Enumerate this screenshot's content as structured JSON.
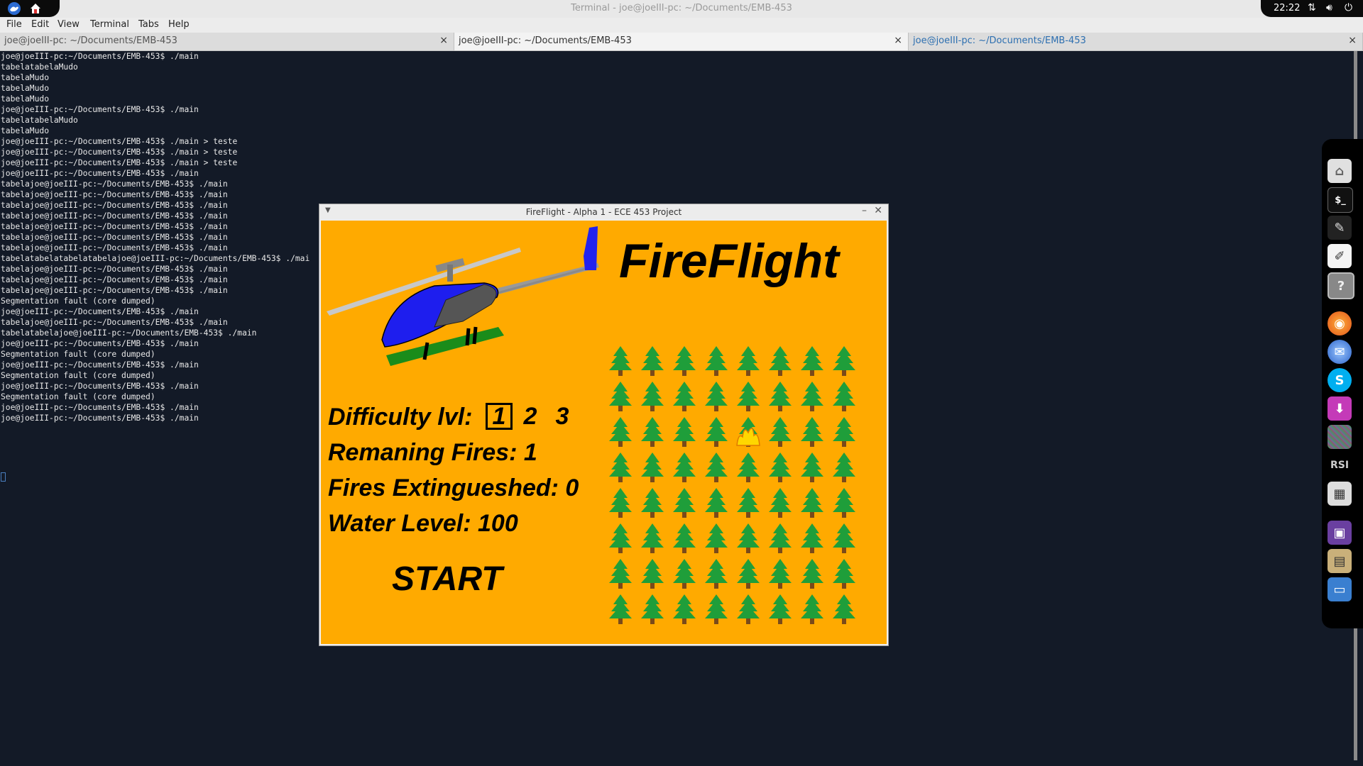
{
  "panel": {
    "window_title": "Terminal - joe@joeIII-pc: ~/Documents/EMB-453",
    "clock": "22:22"
  },
  "menubar": {
    "items": [
      "File",
      "Edit",
      "View",
      "Terminal",
      "Tabs",
      "Help"
    ]
  },
  "tabs": [
    {
      "label": "joe@joeIII-pc: ~/Documents/EMB-453",
      "close": "×"
    },
    {
      "label": "joe@joeIII-pc: ~/Documents/EMB-453",
      "close": "×"
    },
    {
      "label": "joe@joeIII-pc: ~/Documents/EMB-453",
      "close": "×"
    }
  ],
  "terminal": {
    "lines": [
      "joe@joeIII-pc:~/Documents/EMB-453$ ./main",
      "tabelatabelaMudo",
      "tabelaMudo",
      "tabelaMudo",
      "tabelaMudo",
      "joe@joeIII-pc:~/Documents/EMB-453$ ./main",
      "tabelatabelaMudo",
      "tabelaMudo",
      "joe@joeIII-pc:~/Documents/EMB-453$ ./main > teste",
      "joe@joeIII-pc:~/Documents/EMB-453$ ./main > teste",
      "joe@joeIII-pc:~/Documents/EMB-453$ ./main > teste",
      "joe@joeIII-pc:~/Documents/EMB-453$ ./main",
      "tabelajoe@joeIII-pc:~/Documents/EMB-453$ ./main",
      "tabelajoe@joeIII-pc:~/Documents/EMB-453$ ./main",
      "tabelajoe@joeIII-pc:~/Documents/EMB-453$ ./main",
      "tabelajoe@joeIII-pc:~/Documents/EMB-453$ ./main",
      "tabelajoe@joeIII-pc:~/Documents/EMB-453$ ./main",
      "tabelajoe@joeIII-pc:~/Documents/EMB-453$ ./main",
      "tabelajoe@joeIII-pc:~/Documents/EMB-453$ ./main",
      "tabelatabelatabelatabelajoe@joeIII-pc:~/Documents/EMB-453$ ./mai",
      "tabelajoe@joeIII-pc:~/Documents/EMB-453$ ./main",
      "tabelajoe@joeIII-pc:~/Documents/EMB-453$ ./main",
      "tabelajoe@joeIII-pc:~/Documents/EMB-453$ ./main",
      "Segmentation fault (core dumped)",
      "joe@joeIII-pc:~/Documents/EMB-453$ ./main",
      "tabelajoe@joeIII-pc:~/Documents/EMB-453$ ./main",
      "tabelatabelajoe@joeIII-pc:~/Documents/EMB-453$ ./main",
      "joe@joeIII-pc:~/Documents/EMB-453$ ./main",
      "Segmentation fault (core dumped)",
      "joe@joeIII-pc:~/Documents/EMB-453$ ./main",
      "Segmentation fault (core dumped)",
      "joe@joeIII-pc:~/Documents/EMB-453$ ./main",
      "Segmentation fault (core dumped)",
      "joe@joeIII-pc:~/Documents/EMB-453$ ./main",
      "joe@joeIII-pc:~/Documents/EMB-453$ ./main"
    ]
  },
  "game": {
    "window_title": "FireFlight - Alpha 1 - ECE 453 Project",
    "logo": "FireFlight",
    "difficulty_label": "Difficulty lvl:",
    "levels": [
      "1",
      "2",
      "3"
    ],
    "selected_level": "1",
    "remaining_fires": "Remaning Fires: 1",
    "fires_extinguished": "Fires Extingueshed: 0",
    "water_level": "Water Level: 100",
    "start": "START",
    "forest": {
      "rows": 8,
      "cols": 8,
      "fire_at": [
        2,
        4
      ]
    },
    "colors": {
      "background": "#ffaa00",
      "tree": "#1f9e3a",
      "trunk": "#7a4a1a",
      "fire": "#ffd700"
    }
  },
  "dock": {
    "icons": [
      "home-folder-icon",
      "terminal-icon",
      "text-editor-icon",
      "notes-icon",
      "help-icon",
      "firefox-icon",
      "thunderbird-icon",
      "skype-icon",
      "download-icon",
      "noise-app-icon",
      "rsi-icon",
      "calculator-icon",
      "purple-app-icon",
      "image-viewer-icon",
      "display-icon"
    ]
  }
}
